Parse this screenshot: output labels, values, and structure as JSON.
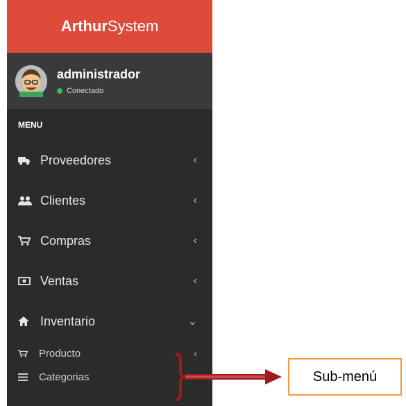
{
  "brand": {
    "name_bold": "Arthur",
    "name_regular": "System",
    "color": "#df4b3a"
  },
  "user": {
    "name": "administrador",
    "status": "Conectado",
    "status_color": "#2fbf55"
  },
  "menu": {
    "header": "MENU",
    "items": [
      {
        "label": "Proveedores",
        "icon": "truck-icon",
        "chevron": "‹"
      },
      {
        "label": "Clientes",
        "icon": "users-icon",
        "chevron": "‹"
      },
      {
        "label": "Compras",
        "icon": "cart-icon",
        "chevron": "‹"
      },
      {
        "label": "Ventas",
        "icon": "money-icon",
        "chevron": "‹"
      },
      {
        "label": "Inventario",
        "icon": "home-icon",
        "chevron": "⌄"
      }
    ],
    "submenu": [
      {
        "label": "Producto",
        "icon": "cart-icon",
        "chevron": "‹"
      },
      {
        "label": "Categorias",
        "icon": "list-icon",
        "chevron": "‹"
      }
    ]
  },
  "annotation": {
    "label": "Sub-menú",
    "bracket_color": "#9e1b1b",
    "box_border": "#f39b3b"
  }
}
